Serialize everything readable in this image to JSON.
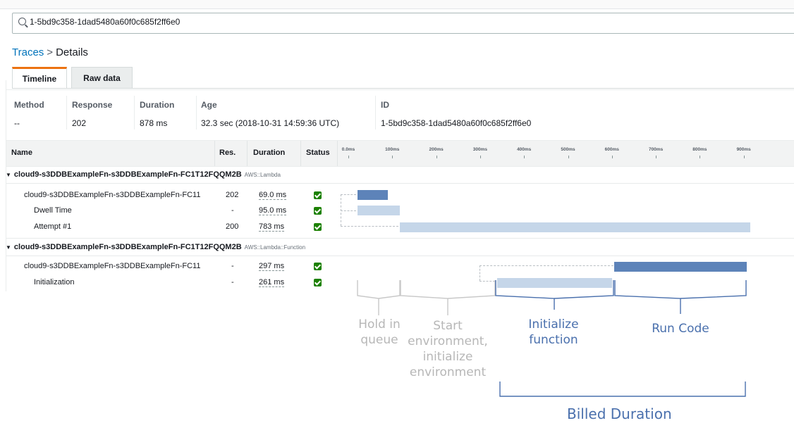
{
  "search": {
    "value": "1-5bd9c358-1dad5480a60f0c685f2ff6e0"
  },
  "breadcrumb": {
    "parent": "Traces",
    "separator": ">",
    "current": "Details"
  },
  "tabs": [
    {
      "label": "Timeline",
      "active": true
    },
    {
      "label": "Raw data",
      "active": false
    }
  ],
  "summary": {
    "method": {
      "label": "Method",
      "value": "--"
    },
    "response": {
      "label": "Response",
      "value": "202"
    },
    "duration": {
      "label": "Duration",
      "value": "878 ms"
    },
    "age": {
      "label": "Age",
      "value": "32.3 sec (2018-10-31 14:59:36 UTC)"
    },
    "id": {
      "label": "ID",
      "value": "1-5bd9c358-1dad5480a60f0c685f2ff6e0"
    }
  },
  "columns": {
    "name": "Name",
    "res": "Res.",
    "duration": "Duration",
    "status": "Status"
  },
  "ticks": [
    "0.0ms",
    "100ms",
    "200ms",
    "300ms",
    "400ms",
    "500ms",
    "600ms",
    "700ms",
    "800ms",
    "900ms"
  ],
  "groups": [
    {
      "name": "cloud9-s3DDBExampleFn-s3DDBExampleFn-FC1T12FQQM2B",
      "kind": "AWS::Lambda",
      "rows": [
        {
          "name": "cloud9-s3DDBExampleFn-s3DDBExampleFn-FC11",
          "res": "202",
          "duration": "69.0 ms",
          "status": "ok"
        },
        {
          "name": "Dwell Time",
          "res": "-",
          "duration": "95.0 ms",
          "status": "ok"
        },
        {
          "name": "Attempt #1",
          "res": "200",
          "duration": "783 ms",
          "status": "ok"
        }
      ]
    },
    {
      "name": "cloud9-s3DDBExampleFn-s3DDBExampleFn-FC1T12FQQM2B",
      "kind": "AWS::Lambda::Function",
      "rows": [
        {
          "name": "cloud9-s3DDBExampleFn-s3DDBExampleFn-FC11",
          "res": "-",
          "duration": "297 ms",
          "status": "ok"
        },
        {
          "name": "Initialization",
          "res": "-",
          "duration": "261 ms",
          "status": "ok"
        }
      ]
    }
  ],
  "annotations": {
    "hold_in_queue": [
      "Hold in",
      "queue"
    ],
    "start_environment": [
      "Start",
      "environment,",
      "initialize",
      "environment"
    ],
    "initialize_function": [
      "Initialize",
      "function"
    ],
    "run_code": [
      "Run Code"
    ],
    "billed_duration": "Billed Duration"
  },
  "colors": {
    "accent_tab": "#ec7211",
    "bar_dark": "#5d83b9",
    "bar_light": "#c5d6e9",
    "annotation_blue": "#4a70ad",
    "annotation_gray": "#b7b7b7",
    "status_ok": "#1d8102"
  }
}
